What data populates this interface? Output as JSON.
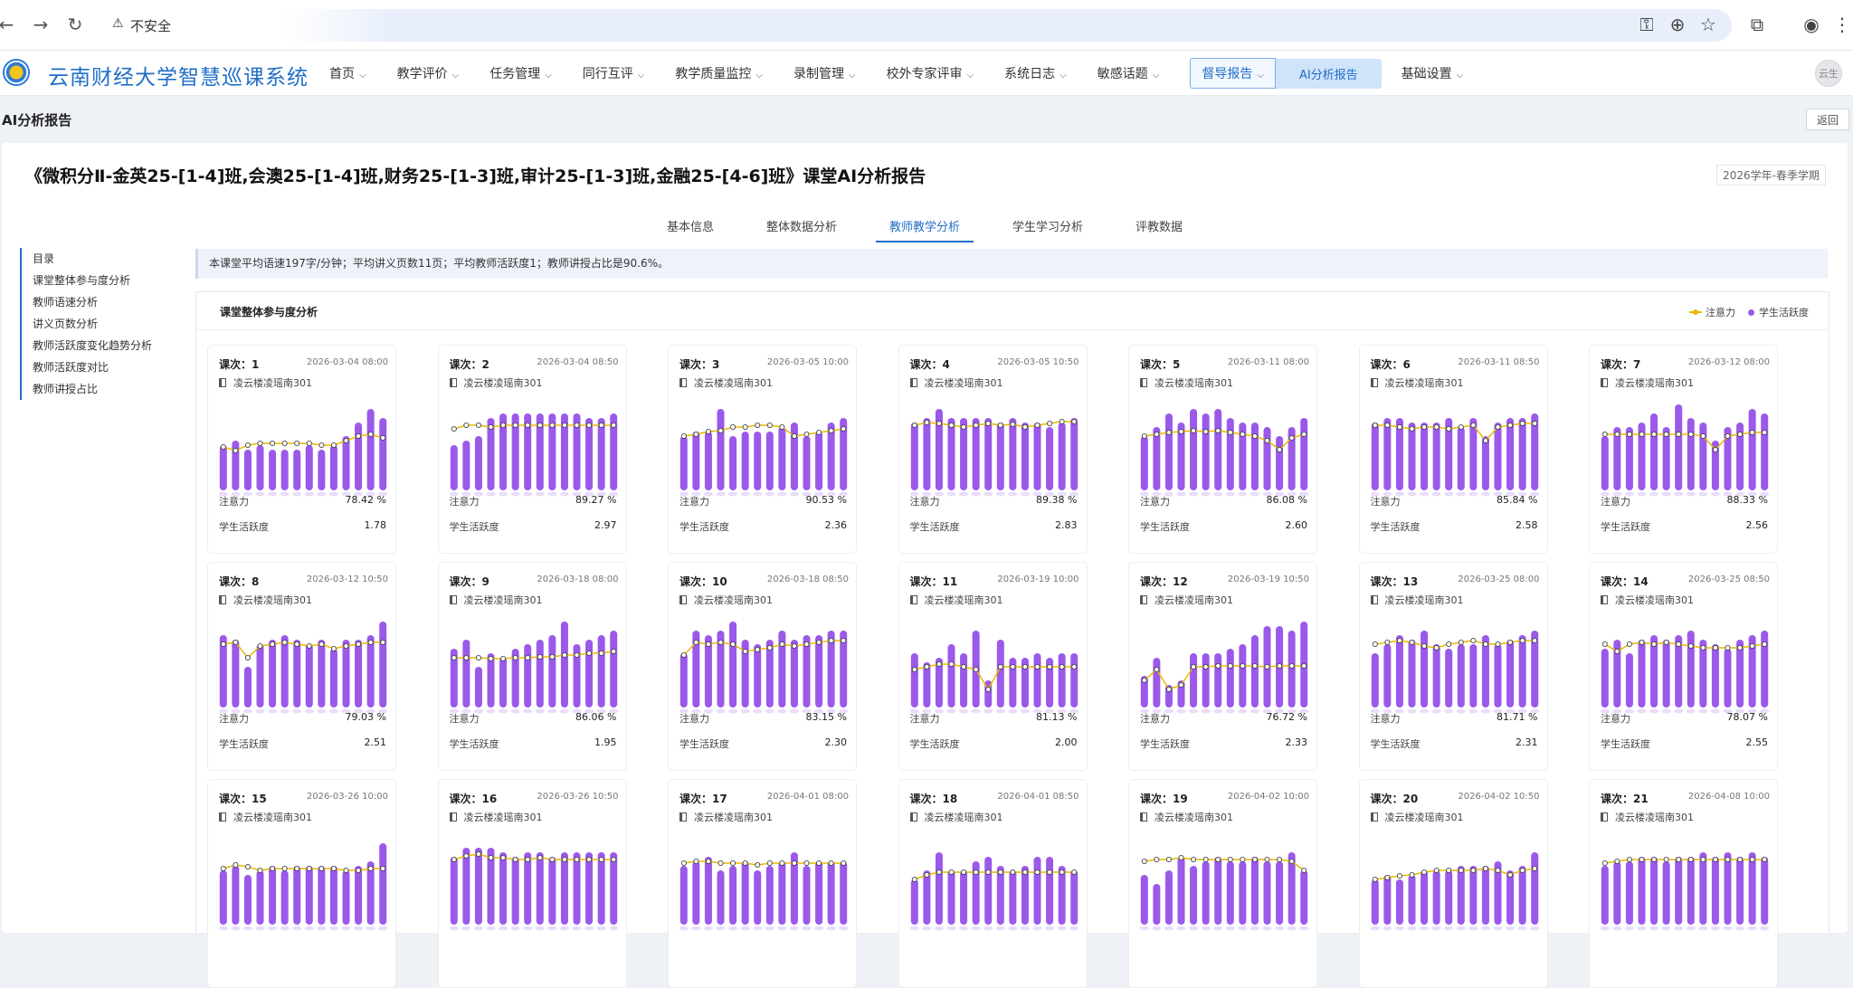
{
  "browser": {
    "security_label": "不安全",
    "url": ""
  },
  "app": {
    "title": "云南财经大学智慧巡课系统",
    "avatar_label": "云生",
    "menu": [
      {
        "label": "首页"
      },
      {
        "label": "教学评价"
      },
      {
        "label": "任务管理"
      },
      {
        "label": "同行互评"
      },
      {
        "label": "教学质量监控"
      },
      {
        "label": "录制管理"
      },
      {
        "label": "校外专家评审"
      },
      {
        "label": "系统日志"
      },
      {
        "label": "敏感话题"
      },
      {
        "label": "督导报告"
      },
      {
        "label": "AI分析报告"
      },
      {
        "label": "基础设置"
      }
    ]
  },
  "page": {
    "title": "AI分析报告",
    "back_label": "返回",
    "report_title": "《微积分Ⅱ-金英25-[1-4]班,会澳25-[1-4]班,财务25-[1-3]班,审计25-[1-3]班,金融25-[4-6]班》课堂AI分析报告",
    "term": "2026学年-春季学期",
    "tabs": [
      "基本信息",
      "整体数据分析",
      "教师教学分析",
      "学生学习分析",
      "评教数据"
    ],
    "active_tab": 2,
    "toc_title": "目录",
    "toc": [
      "课堂整体参与度分析",
      "教师语速分析",
      "讲义页数分析",
      "教师活跃度变化趋势分析",
      "教师活跃度对比",
      "教师讲授占比"
    ],
    "summary": "本课堂平均语速197字/分钟；平均讲义页数11页；平均教师活跃度1；教师讲授占比是90.6%。",
    "panel_title": "课堂整体参与度分析",
    "legend": {
      "attention": "注意力",
      "activity": "学生活跃度"
    },
    "metric_labels": {
      "attention": "注意力",
      "activity": "学生活跃度"
    },
    "colors": {
      "accent": "#1f6ec7",
      "bar": "#9b59ea",
      "attention_line": "#e8b800"
    }
  },
  "lessons": [
    {
      "no": "课次：1",
      "time": "2026-03-04 08:00",
      "room": "凌云楼凌瑶南301",
      "attention": "78.42 %",
      "activity": "1.78",
      "bars": [
        0.5,
        0.55,
        0.45,
        0.5,
        0.45,
        0.45,
        0.45,
        0.5,
        0.45,
        0.5,
        0.6,
        0.75,
        0.9,
        0.8
      ],
      "line": [
        0.48,
        0.44,
        0.5,
        0.52,
        0.52,
        0.52,
        0.52,
        0.52,
        0.5,
        0.5,
        0.55,
        0.6,
        0.62,
        0.58
      ]
    },
    {
      "no": "课次：2",
      "time": "2026-03-04 08:50",
      "room": "凌云楼凌瑶南301",
      "attention": "89.27 %",
      "activity": "2.97",
      "bars": [
        0.5,
        0.55,
        0.6,
        0.8,
        0.85,
        0.85,
        0.85,
        0.85,
        0.85,
        0.85,
        0.85,
        0.8,
        0.8,
        0.85
      ],
      "line": [
        0.68,
        0.72,
        0.72,
        0.7,
        0.72,
        0.72,
        0.72,
        0.72,
        0.72,
        0.72,
        0.72,
        0.72,
        0.72,
        0.72
      ]
    },
    {
      "no": "课次：3",
      "time": "2026-03-05 10:00",
      "room": "凌云楼凌瑶南301",
      "attention": "90.53 %",
      "activity": "2.36",
      "bars": [
        0.6,
        0.65,
        0.65,
        0.9,
        0.6,
        0.65,
        0.65,
        0.65,
        0.7,
        0.75,
        0.6,
        0.65,
        0.75,
        0.8
      ],
      "line": [
        0.6,
        0.62,
        0.65,
        0.66,
        0.7,
        0.7,
        0.72,
        0.72,
        0.7,
        0.6,
        0.62,
        0.64,
        0.66,
        0.68
      ]
    },
    {
      "no": "课次：4",
      "time": "2026-03-05 10:50",
      "room": "凌云楼凌瑶南301",
      "attention": "89.38 %",
      "activity": "2.83",
      "bars": [
        0.75,
        0.8,
        0.9,
        0.8,
        0.8,
        0.8,
        0.8,
        0.75,
        0.8,
        0.75,
        0.75,
        0.7,
        0.75,
        0.8
      ],
      "line": [
        0.72,
        0.75,
        0.74,
        0.72,
        0.7,
        0.72,
        0.74,
        0.72,
        0.73,
        0.7,
        0.72,
        0.74,
        0.76,
        0.76
      ]
    },
    {
      "no": "课次：5",
      "time": "2026-03-11 08:00",
      "room": "凌云楼凌瑶南301",
      "attention": "86.08 %",
      "activity": "2.60",
      "bars": [
        0.6,
        0.7,
        0.85,
        0.75,
        0.9,
        0.85,
        0.9,
        0.8,
        0.75,
        0.75,
        0.7,
        0.6,
        0.7,
        0.8
      ],
      "line": [
        0.6,
        0.62,
        0.64,
        0.65,
        0.66,
        0.65,
        0.66,
        0.64,
        0.62,
        0.6,
        0.55,
        0.45,
        0.58,
        0.62
      ]
    },
    {
      "no": "课次：6",
      "time": "2026-03-11 08:50",
      "room": "凌云楼凌瑶南301",
      "attention": "85.84 %",
      "activity": "2.58",
      "bars": [
        0.75,
        0.8,
        0.8,
        0.75,
        0.75,
        0.75,
        0.8,
        0.7,
        0.8,
        0.6,
        0.75,
        0.8,
        0.8,
        0.85
      ],
      "line": [
        0.72,
        0.72,
        0.7,
        0.68,
        0.7,
        0.7,
        0.68,
        0.7,
        0.72,
        0.55,
        0.7,
        0.72,
        0.74,
        0.74
      ]
    },
    {
      "no": "课次：7",
      "time": "2026-03-12 08:00",
      "room": "凌云楼凌瑶南301",
      "attention": "88.33 %",
      "activity": "2.56",
      "bars": [
        0.6,
        0.7,
        0.7,
        0.75,
        0.85,
        0.7,
        0.95,
        0.8,
        0.75,
        0.55,
        0.7,
        0.75,
        0.9,
        0.85
      ],
      "line": [
        0.62,
        0.62,
        0.62,
        0.62,
        0.62,
        0.62,
        0.62,
        0.62,
        0.6,
        0.45,
        0.6,
        0.62,
        0.64,
        0.64
      ]
    },
    {
      "no": "课次：8",
      "time": "2026-03-12 10:50",
      "room": "凌云楼凌瑶南301",
      "attention": "79.03 %",
      "activity": "2.51",
      "bars": [
        0.8,
        0.75,
        0.45,
        0.7,
        0.75,
        0.8,
        0.75,
        0.7,
        0.75,
        0.65,
        0.75,
        0.75,
        0.8,
        0.95
      ],
      "line": [
        0.7,
        0.72,
        0.55,
        0.68,
        0.7,
        0.72,
        0.7,
        0.68,
        0.7,
        0.65,
        0.68,
        0.7,
        0.72,
        0.72
      ]
    },
    {
      "no": "课次：9",
      "time": "2026-03-18 08:00",
      "room": "凌云楼凌瑶南301",
      "attention": "86.06 %",
      "activity": "1.95",
      "bars": [
        0.65,
        0.75,
        0.45,
        0.6,
        0.55,
        0.65,
        0.7,
        0.75,
        0.8,
        0.95,
        0.7,
        0.75,
        0.8,
        0.85
      ],
      "line": [
        0.55,
        0.55,
        0.55,
        0.54,
        0.54,
        0.55,
        0.55,
        0.56,
        0.56,
        0.58,
        0.58,
        0.6,
        0.6,
        0.62
      ]
    },
    {
      "no": "课次：10",
      "time": "2026-03-18 08:50",
      "room": "凌云楼凌瑶南301",
      "attention": "83.15 %",
      "activity": "2.30",
      "bars": [
        0.6,
        0.85,
        0.8,
        0.85,
        0.95,
        0.75,
        0.7,
        0.75,
        0.85,
        0.75,
        0.8,
        0.8,
        0.85,
        0.85
      ],
      "line": [
        0.58,
        0.72,
        0.7,
        0.72,
        0.7,
        0.62,
        0.64,
        0.66,
        0.7,
        0.68,
        0.7,
        0.72,
        0.74,
        0.74
      ]
    },
    {
      "no": "课次：11",
      "time": "2026-03-19 10:00",
      "room": "凌云楼凌瑶南301",
      "attention": "81.13 %",
      "activity": "2.00",
      "bars": [
        0.6,
        0.5,
        0.55,
        0.7,
        0.6,
        0.85,
        0.3,
        0.75,
        0.55,
        0.55,
        0.6,
        0.55,
        0.6,
        0.6
      ],
      "line": [
        0.42,
        0.45,
        0.48,
        0.48,
        0.45,
        0.42,
        0.2,
        0.45,
        0.45,
        0.45,
        0.45,
        0.45,
        0.45,
        0.45
      ]
    },
    {
      "no": "课次：12",
      "time": "2026-03-19 10:50",
      "room": "凌云楼凌瑶南301",
      "attention": "76.72 %",
      "activity": "2.33",
      "bars": [
        0.35,
        0.55,
        0.25,
        0.3,
        0.6,
        0.6,
        0.6,
        0.65,
        0.7,
        0.8,
        0.9,
        0.9,
        0.85,
        0.95
      ],
      "line": [
        0.3,
        0.42,
        0.2,
        0.25,
        0.45,
        0.45,
        0.46,
        0.46,
        0.46,
        0.46,
        0.45,
        0.46,
        0.46,
        0.46
      ]
    },
    {
      "no": "课次：13",
      "time": "2026-03-25 08:00",
      "room": "凌云楼凌瑶南301",
      "attention": "81.71 %",
      "activity": "2.31",
      "bars": [
        0.6,
        0.7,
        0.8,
        0.75,
        0.85,
        0.7,
        0.65,
        0.7,
        0.7,
        0.8,
        0.7,
        0.75,
        0.8,
        0.85
      ],
      "line": [
        0.7,
        0.72,
        0.74,
        0.72,
        0.68,
        0.66,
        0.7,
        0.72,
        0.74,
        0.7,
        0.7,
        0.72,
        0.74,
        0.74
      ]
    },
    {
      "no": "课次：14",
      "time": "2026-03-25 08:50",
      "room": "凌云楼凌瑶南301",
      "attention": "78.07 %",
      "activity": "2.55",
      "bars": [
        0.65,
        0.75,
        0.6,
        0.75,
        0.8,
        0.75,
        0.8,
        0.85,
        0.75,
        0.7,
        0.65,
        0.75,
        0.8,
        0.85
      ],
      "line": [
        0.7,
        0.62,
        0.7,
        0.72,
        0.7,
        0.72,
        0.7,
        0.68,
        0.66,
        0.66,
        0.66,
        0.66,
        0.68,
        0.7
      ]
    },
    {
      "no": "课次：15",
      "time": "2026-03-26 10:00",
      "room": "凌云楼凌瑶南301",
      "attention": "",
      "activity": "",
      "bars": [
        0.6,
        0.65,
        0.55,
        0.6,
        0.65,
        0.6,
        0.65,
        0.65,
        0.65,
        0.65,
        0.6,
        0.65,
        0.7,
        0.9
      ],
      "line": [
        0.62,
        0.66,
        0.64,
        0.6,
        0.62,
        0.62,
        0.62,
        0.62,
        0.62,
        0.62,
        0.6,
        0.6,
        0.62,
        0.62
      ]
    },
    {
      "no": "课次：16",
      "time": "2026-03-26 10:50",
      "room": "凌云楼凌瑶南301",
      "attention": "",
      "activity": "",
      "bars": [
        0.75,
        0.85,
        0.85,
        0.85,
        0.8,
        0.75,
        0.8,
        0.8,
        0.75,
        0.8,
        0.8,
        0.8,
        0.8,
        0.8
      ],
      "line": [
        0.72,
        0.76,
        0.78,
        0.74,
        0.74,
        0.72,
        0.72,
        0.74,
        0.72,
        0.72,
        0.72,
        0.72,
        0.72,
        0.72
      ]
    },
    {
      "no": "课次：17",
      "time": "2026-04-01 08:00",
      "room": "凌云楼凌瑶南301",
      "attention": "",
      "activity": "",
      "bars": [
        0.65,
        0.7,
        0.75,
        0.6,
        0.65,
        0.7,
        0.6,
        0.65,
        0.7,
        0.8,
        0.65,
        0.7,
        0.7,
        0.7
      ],
      "line": [
        0.68,
        0.7,
        0.7,
        0.68,
        0.68,
        0.68,
        0.66,
        0.68,
        0.68,
        0.68,
        0.68,
        0.68,
        0.68,
        0.68
      ]
    },
    {
      "no": "课次：18",
      "time": "2026-04-01 08:50",
      "room": "凌云楼凌瑶南301",
      "attention": "",
      "activity": "",
      "bars": [
        0.5,
        0.6,
        0.8,
        0.6,
        0.6,
        0.7,
        0.75,
        0.65,
        0.6,
        0.65,
        0.75,
        0.75,
        0.65,
        0.6
      ],
      "line": [
        0.5,
        0.55,
        0.58,
        0.58,
        0.58,
        0.58,
        0.58,
        0.58,
        0.58,
        0.58,
        0.58,
        0.58,
        0.58,
        0.58
      ]
    },
    {
      "no": "课次：19",
      "time": "2026-04-02 10:00",
      "room": "凌云楼凌瑶南301",
      "attention": "",
      "activity": "",
      "bars": [
        0.55,
        0.45,
        0.6,
        0.75,
        0.65,
        0.7,
        0.75,
        0.7,
        0.7,
        0.75,
        0.7,
        0.7,
        0.8,
        0.6
      ],
      "line": [
        0.7,
        0.72,
        0.72,
        0.74,
        0.72,
        0.72,
        0.72,
        0.72,
        0.72,
        0.72,
        0.72,
        0.72,
        0.7,
        0.6
      ]
    },
    {
      "no": "课次：20",
      "time": "2026-04-02 10:50",
      "room": "凌云楼凌瑶南301",
      "attention": "",
      "activity": "",
      "bars": [
        0.5,
        0.55,
        0.5,
        0.55,
        0.6,
        0.6,
        0.6,
        0.65,
        0.65,
        0.65,
        0.7,
        0.6,
        0.65,
        0.8
      ],
      "line": [
        0.5,
        0.52,
        0.54,
        0.55,
        0.58,
        0.6,
        0.6,
        0.6,
        0.6,
        0.62,
        0.6,
        0.55,
        0.6,
        0.62
      ]
    },
    {
      "no": "课次：21",
      "time": "2026-04-08 10:00",
      "room": "凌云楼凌瑶南301",
      "attention": "",
      "activity": "",
      "bars": [
        0.65,
        0.7,
        0.7,
        0.75,
        0.75,
        0.7,
        0.75,
        0.75,
        0.8,
        0.75,
        0.8,
        0.75,
        0.8,
        0.75
      ],
      "line": [
        0.68,
        0.7,
        0.72,
        0.72,
        0.72,
        0.72,
        0.72,
        0.72,
        0.72,
        0.72,
        0.72,
        0.72,
        0.72,
        0.72
      ]
    }
  ]
}
